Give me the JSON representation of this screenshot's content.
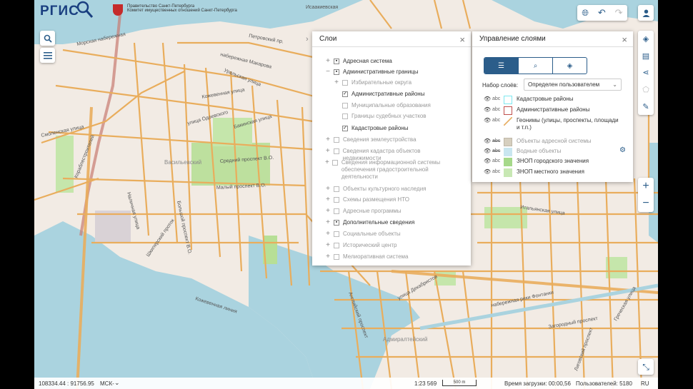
{
  "app": {
    "logo": "РГИС",
    "org_line1": "Правительство Санкт-Петербурга",
    "org_line2": "Комитет имущественных отношений Санкт-Петербурга"
  },
  "map_labels": [
    "Морская набережная",
    "набережная Макарова",
    "Петровский пр.",
    "Уральская улица",
    "Кожевенная улица",
    "Наличная улица",
    "Малый проспект В.О.",
    "Средний проспект В.О.",
    "Большой проспект В.О.",
    "Кожевенная линия",
    "Смоленская улица",
    "улица Одоевского",
    "Бакинская улица",
    "Кораблестроителей",
    "Шкиперский проток",
    "Итальянская улица",
    "улица Декабристов",
    "Загородный проспект",
    "набережная реки Фонтанки",
    "Английский проспект",
    "Адмиралтейский",
    "Васильевский",
    "Греческая улица",
    "Исаакиевская",
    "Лиговский проспект"
  ],
  "layers_panel": {
    "title": "Слои",
    "items": [
      {
        "label": "Адресная система",
        "expander": "+",
        "check": "partial",
        "dim": false
      },
      {
        "label": "Административные границы",
        "expander": "−",
        "check": "partial",
        "dim": false
      },
      {
        "label": "Избирательные округа",
        "expander": "+",
        "check": "off",
        "dim": true
      },
      {
        "label": "Административные районы",
        "expander": "",
        "check": "on",
        "dim": false
      },
      {
        "label": "Муниципальные образования",
        "expander": "",
        "check": "off",
        "dim": true
      },
      {
        "label": "Границы судебных участков",
        "expander": "",
        "check": "off",
        "dim": true
      },
      {
        "label": "Кадастровые районы",
        "expander": "",
        "check": "on",
        "dim": false
      },
      {
        "label": "Сведения землеустройства",
        "expander": "+",
        "check": "off",
        "dim": true
      },
      {
        "label": "Сведения кадастра объектов недвижимости",
        "expander": "+",
        "check": "off",
        "dim": true
      },
      {
        "label": "Сведения информационной системы обеспечения градостроительной деятельности",
        "expander": "+",
        "check": "off",
        "dim": true
      },
      {
        "label": "Объекты культурного наследия",
        "expander": "+",
        "check": "off",
        "dim": true
      },
      {
        "label": "Схемы размещения НТО",
        "expander": "+",
        "check": "off",
        "dim": true
      },
      {
        "label": "Адресные программы",
        "expander": "+",
        "check": "off",
        "dim": true
      },
      {
        "label": "Дополнительные сведения",
        "expander": "+",
        "check": "partial",
        "dim": false
      },
      {
        "label": "Социальные объекты",
        "expander": "+",
        "check": "off",
        "dim": true
      },
      {
        "label": "Исторический центр",
        "expander": "+",
        "check": "off",
        "dim": true
      },
      {
        "label": "Мелиоративная система",
        "expander": "+",
        "check": "off",
        "dim": true
      }
    ]
  },
  "manage_panel": {
    "title": "Управление слоями",
    "set_label": "Набор слоёв:",
    "set_value": "Определен пользователем",
    "items": [
      {
        "abc": "abc",
        "label": "Кадастровые районы",
        "swatch": "#7ee8f0",
        "fill": "#ffffff",
        "dim": false
      },
      {
        "abc": "abc",
        "label": "Административные районы",
        "swatch": "#c0504d",
        "fill": "#ffffff",
        "dim": false
      },
      {
        "abc": "abc",
        "label": "Геонимы (улицы, проспекты, площади и т.п.)",
        "swatch": "#e8b26a",
        "fill": "line",
        "dim": false
      },
      {
        "abc": "abc",
        "label": "Объекты адресной системы",
        "swatch": "#bfb8a8",
        "fill": "#d6cfbf",
        "dim": true
      },
      {
        "abc": "abc",
        "label": "Водные объекты",
        "swatch": "#c9e6f0",
        "fill": "#c9e6f0",
        "dim": true
      },
      {
        "abc": "abc",
        "label": "ЗНОП городского значения",
        "swatch": "#a6d98a",
        "fill": "#a6d98a",
        "dim": false
      },
      {
        "abc": "abc",
        "label": "ЗНОП местного значения",
        "swatch": "#c8e8b4",
        "fill": "#c8e8b4",
        "dim": false
      }
    ]
  },
  "statusbar": {
    "coords": "108334.44 : 91756.95",
    "crs": "МСК-",
    "scale": "1:23 569",
    "scalebar": "500 m",
    "load_time": "Время загрузки: 00:00,56",
    "users": "Пользователей: 5180",
    "lang": "RU"
  },
  "icons": [
    "search-icon",
    "menu-icon",
    "globe-icon",
    "undo-icon",
    "redo-icon",
    "user-icon",
    "layers-icon",
    "print-icon",
    "share-icon",
    "measure-icon",
    "pencil-icon",
    "zoom-in-icon",
    "zoom-out-icon",
    "fullscreen-icon"
  ]
}
